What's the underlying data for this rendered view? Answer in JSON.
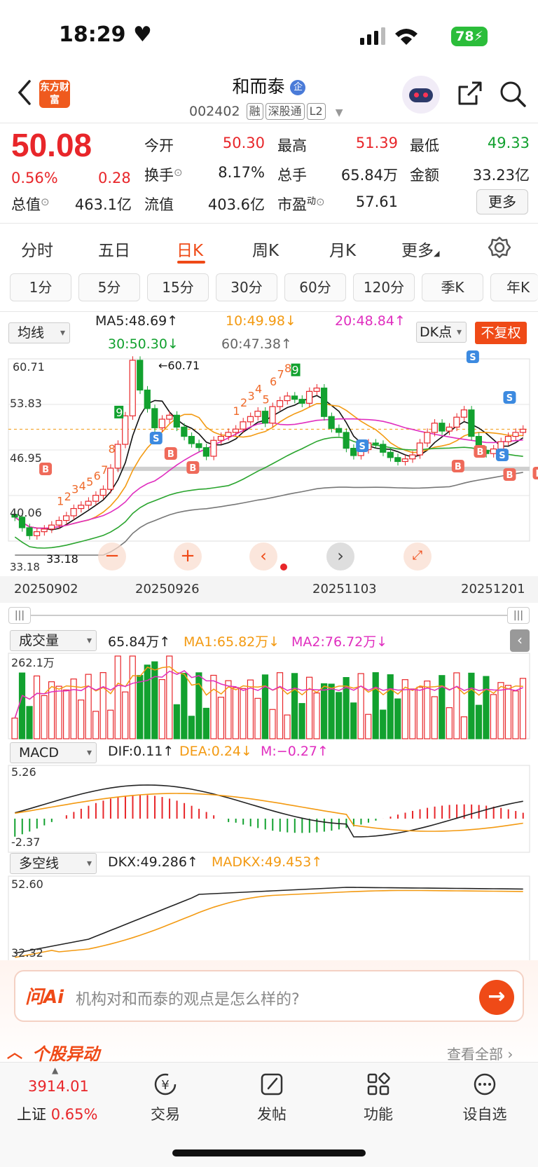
{
  "status_bar": {
    "time": "18:29",
    "battery": "78"
  },
  "header": {
    "app_logo": "东方财富",
    "title": "和而泰",
    "title_badge": "企",
    "code": "002402",
    "tags": [
      "融",
      "深股通",
      "L2"
    ]
  },
  "quote": {
    "price": "50.08",
    "change_pct": "0.56%",
    "change": "0.28",
    "fields": [
      {
        "label": "今开",
        "value": "50.30",
        "color": "#e8262a"
      },
      {
        "label": "最高",
        "value": "51.39",
        "color": "#e8262a"
      },
      {
        "label": "最低",
        "value": "49.33",
        "color": "#12a12f"
      },
      {
        "label": "换手",
        "value": "8.17%",
        "color": "#222222"
      },
      {
        "label": "总手",
        "value": "65.84万",
        "color": "#222222"
      },
      {
        "label": "金额",
        "value": "33.23亿",
        "color": "#222222"
      },
      {
        "label": "总值",
        "value": "463.1亿",
        "color": "#222222"
      },
      {
        "label": "流值",
        "value": "403.6亿",
        "color": "#222222"
      },
      {
        "label": "市盈",
        "value": "57.61",
        "color": "#222222"
      }
    ],
    "pe_sup": "动",
    "more_button": "更多"
  },
  "period_tabs": [
    "分时",
    "五日",
    "日K",
    "周K",
    "月K",
    "更多"
  ],
  "interval_buttons": [
    "1分",
    "5分",
    "15分",
    "30分",
    "60分",
    "120分",
    "季K",
    "年K"
  ],
  "kline": {
    "indicator_select": "均线",
    "ma5": "MA5:48.69↑",
    "ma10": "10:49.98↓",
    "ma20": "20:48.84↑",
    "ma30": "30:50.30↓",
    "ma60": "60:47.38↑",
    "dk_button": "DK点",
    "adjust_button": "不复权",
    "y_labels": [
      "60.71",
      "53.83",
      "46.95",
      "40.06",
      "33.18"
    ],
    "high_marker": "←60.71",
    "low_marker": "33.18",
    "dates": [
      "20250902",
      "20250926",
      "20251103",
      "20251201"
    ],
    "seq_numbers": [
      "1",
      "2",
      "3",
      "4",
      "5",
      "6",
      "7",
      "8",
      "9",
      "1",
      "2",
      "3",
      "4",
      "5",
      "6",
      "7",
      "8",
      "9"
    ]
  },
  "volume": {
    "select": "成交量",
    "value": "65.84万↑",
    "ma1": "MA1:65.82万↓",
    "ma2": "MA2:76.72万↓",
    "max_label": "262.1万"
  },
  "macd": {
    "select": "MACD",
    "dif": "DIF:0.11↑",
    "dea": "DEA:0.24↓",
    "m": "M:−0.27↑",
    "top_label": "5.26",
    "bottom_label": "-2.37"
  },
  "dkx": {
    "select": "多空线",
    "dkx": "DKX:49.286↑",
    "madkx": "MADKX:49.453↑",
    "top_label": "52.60",
    "bottom_label": "32.32"
  },
  "ai": {
    "logo": "问Ai",
    "question": "机构对和而泰的观点是怎么样的?"
  },
  "section": {
    "title": "个股异动",
    "view_all": "查看全部"
  },
  "bottom_nav": {
    "index_value": "3914.01",
    "index_name": "上证",
    "index_pct": "0.65%",
    "items": [
      "交易",
      "发帖",
      "功能",
      "设自选"
    ]
  },
  "colors": {
    "up": "#e8262a",
    "down": "#12a12f",
    "accent": "#ef4a17"
  }
}
